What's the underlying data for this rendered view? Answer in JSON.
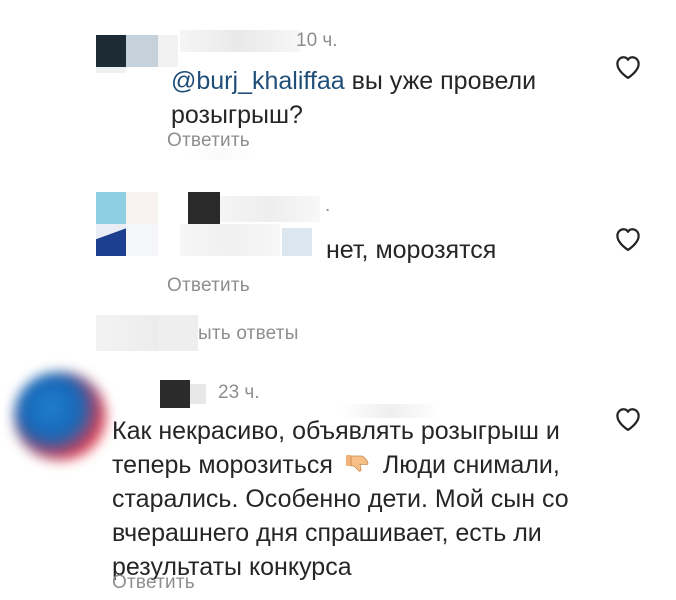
{
  "comments": [
    {
      "time": "10 ч.",
      "mention": "@burj_khaliffaa",
      "text_line1_rest": " вы уже провели",
      "text_line2": "розыгрыш?",
      "reply_label": "Ответить"
    },
    {
      "time": ".",
      "text": "нет, морозятся",
      "reply_label": "Ответить",
      "view_replies_label": "ыть ответы"
    },
    {
      "time": "23 ч.",
      "text_line1": "Как некрасиво, объявлять розыгрыш и",
      "text_line2_a": "теперь морозиться",
      "text_line2_b": "Люди снимали,",
      "text_line3": "старались. Особенно дети. Мой сын со",
      "text_line4": "вчерашнего дня спрашивает, есть ли",
      "text_line5": "результаты конкурса",
      "reply_label": "Ответить"
    }
  ],
  "icons": {
    "like": "heart-outline-icon",
    "dislike_emoji": "thumbs-down-emoji"
  },
  "colors": {
    "text": "#262626",
    "secondary": "#8e8e8e",
    "mention": "#1f4e79",
    "background": "#ffffff"
  }
}
